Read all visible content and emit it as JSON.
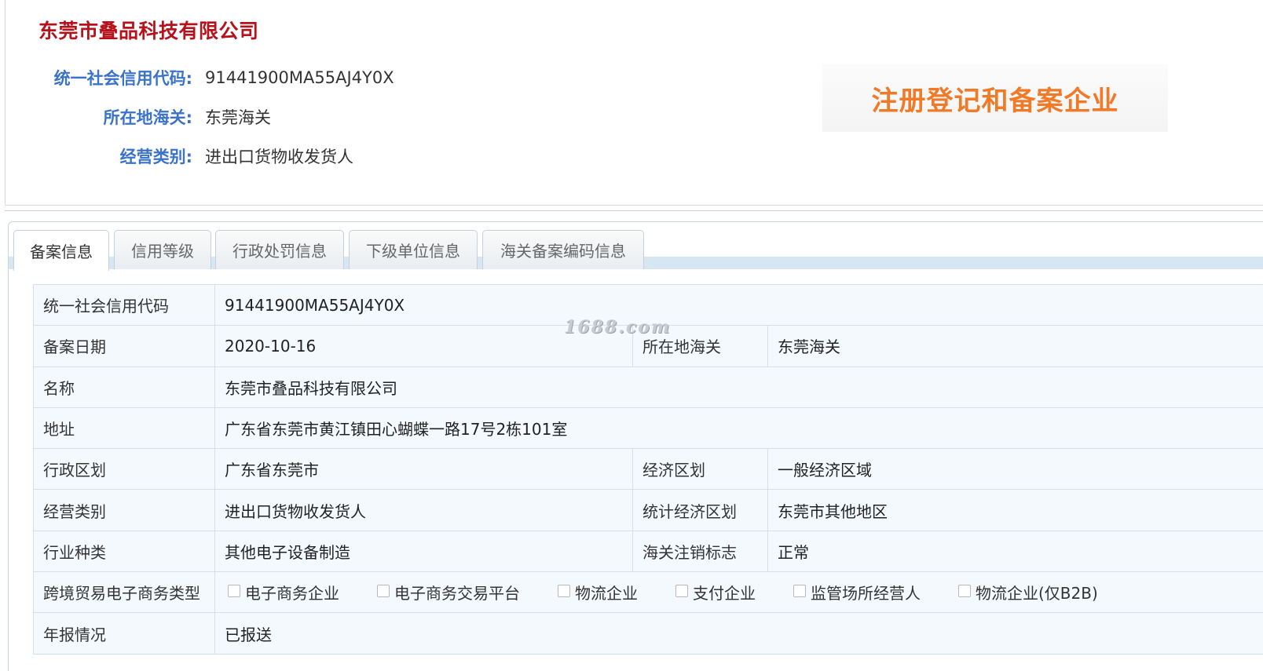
{
  "header": {
    "company_name": "东莞市叠品科技有限公司",
    "fields": [
      {
        "label": "统一社会信用代码:",
        "value": "91441900MA55AJ4Y0X"
      },
      {
        "label": "所在地海关:",
        "value": "东莞海关"
      },
      {
        "label": "经营类别:",
        "value": "进出口货物收发货人"
      }
    ],
    "stamp_text": "注册登记和备案企业"
  },
  "tabs": [
    {
      "label": "备案信息",
      "active": true
    },
    {
      "label": "信用等级",
      "active": false
    },
    {
      "label": "行政处罚信息",
      "active": false
    },
    {
      "label": "下级单位信息",
      "active": false
    },
    {
      "label": "海关备案编码信息",
      "active": false
    }
  ],
  "table": {
    "credit_code": {
      "label": "统一社会信用代码",
      "value": "91441900MA55AJ4Y0X"
    },
    "record_date": {
      "label": "备案日期",
      "value": "2020-10-16"
    },
    "customs": {
      "label": "所在地海关",
      "value": "东莞海关"
    },
    "name": {
      "label": "名称",
      "value": "东莞市叠品科技有限公司"
    },
    "address": {
      "label": "地址",
      "value": "广东省东莞市黄江镇田心蝴蝶一路17号2栋101室"
    },
    "admin_region": {
      "label": "行政区划",
      "value": "广东省东莞市"
    },
    "econ_region": {
      "label": "经济区划",
      "value": "一般经济区域"
    },
    "business_type": {
      "label": "经营类别",
      "value": "进出口货物收发货人"
    },
    "stat_econ_region": {
      "label": "统计经济区划",
      "value": "东莞市其他地区"
    },
    "industry": {
      "label": "行业种类",
      "value": "其他电子设备制造"
    },
    "cancel_flag": {
      "label": "海关注销标志",
      "value": "正常"
    },
    "ecommerce": {
      "label": "跨境贸易电子商务类型",
      "options": [
        "电子商务企业",
        "电子商务交易平台",
        "物流企业",
        "支付企业",
        "监管场所经营人",
        "物流企业(仅B2B)"
      ]
    },
    "annual_report": {
      "label": "年报情况",
      "value": "已报送"
    }
  },
  "watermark": "1688.com",
  "colors": {
    "title": "#b5121b",
    "label_blue": "#3a73c9",
    "stamp_orange": "#f07a28"
  }
}
